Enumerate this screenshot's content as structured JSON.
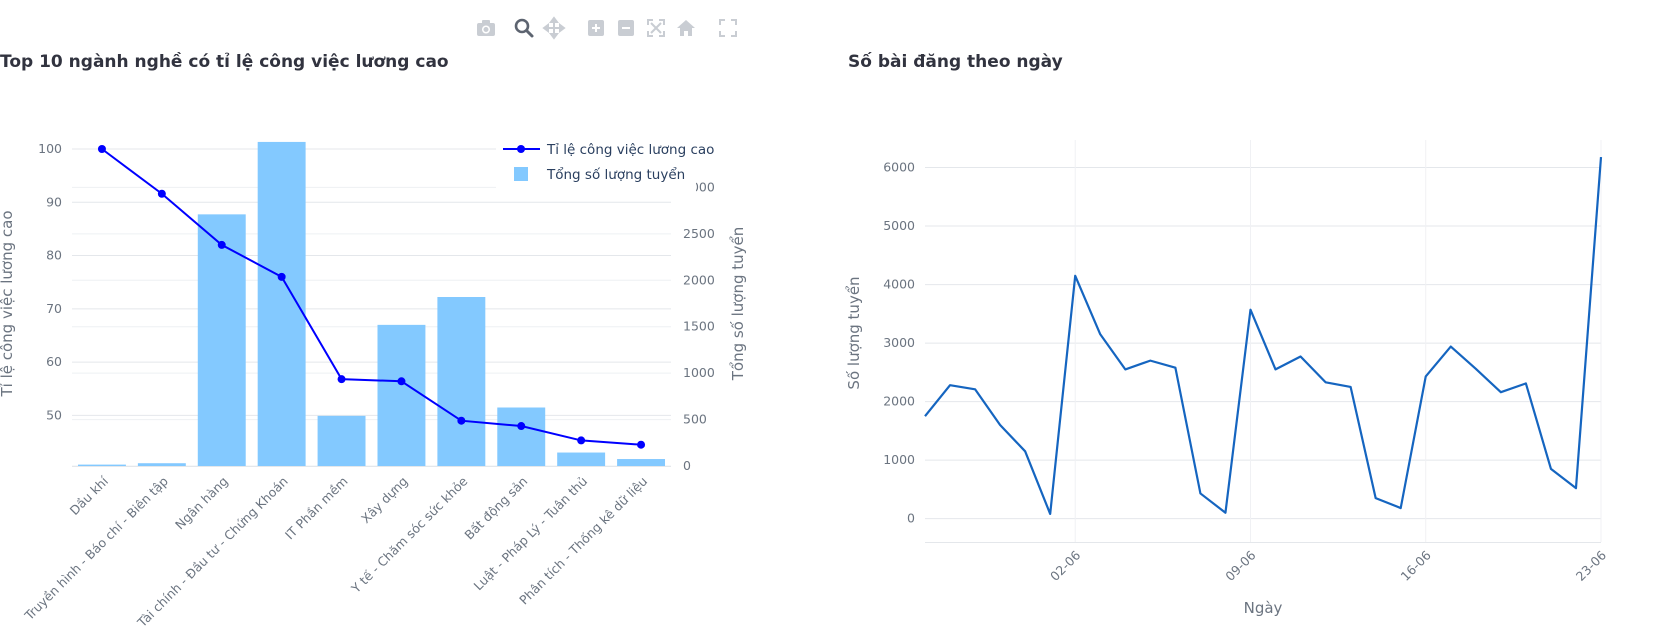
{
  "modebar": {
    "buttons": [
      {
        "name": "camera-icon",
        "label": "Download plot as a png",
        "active": false
      },
      {
        "name": "zoom-icon",
        "label": "Zoom",
        "active": true
      },
      {
        "name": "pan-icon",
        "label": "Pan",
        "active": false
      },
      {
        "name": "zoom-in-icon",
        "label": "Zoom in",
        "active": false
      },
      {
        "name": "zoom-out-icon",
        "label": "Zoom out",
        "active": false
      },
      {
        "name": "autoscale-icon",
        "label": "Autoscale",
        "active": false
      },
      {
        "name": "home-icon",
        "label": "Reset axes",
        "active": false
      },
      {
        "name": "fullscreen-icon",
        "label": "Fullscreen",
        "active": false
      }
    ]
  },
  "chart_data": [
    {
      "type": "bar",
      "title": "Top 10 ngành nghề có tỉ lệ công việc lương cao",
      "xlabel": "",
      "categories": [
        "Dầu khí",
        "Truyền hình - Báo chí - Biên tập",
        "Ngân hàng",
        "Tài chính - Đầu tư - Chứng Khoán",
        "IT Phần mềm",
        "Xây dựng",
        "Y tế - Chăm sóc sức khỏe",
        "Bất động sản",
        "Luật - Pháp Lý - Tuân thủ",
        "Phân tích - Thống kê dữ liệu"
      ],
      "y1label": "Tỉ lệ công việc lương cao",
      "y2label": "Tổng số lượng tuyển",
      "y1lim": [
        40.5,
        101.5
      ],
      "y2lim": [
        0,
        3500
      ],
      "y1ticks": [
        50,
        60,
        70,
        80,
        90,
        100
      ],
      "y2ticks": [
        0,
        500,
        1000,
        1500,
        2000,
        2500,
        3000
      ],
      "series": [
        {
          "name": "Tỉ lệ công việc lương cao",
          "type": "line",
          "axis": "y1",
          "color": "#0000ff",
          "values": [
            100,
            91.6,
            82,
            76,
            56.8,
            56.4,
            49,
            48,
            45.3,
            44.5
          ]
        },
        {
          "name": "Tổng số lượng tuyển",
          "type": "bar",
          "axis": "y2",
          "color": "#83c9ff",
          "values": [
            15,
            30,
            2710,
            3490,
            540,
            1520,
            1820,
            630,
            145,
            75
          ]
        }
      ],
      "legend": "top-right",
      "grid": true
    },
    {
      "type": "line",
      "title": "Số bài đăng theo ngày",
      "xlabel": "Ngày",
      "ylabel": "Số lượng tuyển",
      "ylim": [
        -400,
        6300
      ],
      "yticks": [
        0,
        1000,
        2000,
        3000,
        4000,
        5000,
        6000
      ],
      "xlim": [
        "2024-05-27",
        "2024-06-23"
      ],
      "xticks": [
        {
          "date": "2024-06-02",
          "label": "02-06"
        },
        {
          "date": "2024-06-09",
          "label": "09-06"
        },
        {
          "date": "2024-06-16",
          "label": "16-06"
        },
        {
          "date": "2024-06-23",
          "label": "23-06"
        }
      ],
      "color": "#1565c0",
      "grid": true,
      "x": [
        "2024-05-27",
        "2024-05-28",
        "2024-05-29",
        "2024-05-30",
        "2024-05-31",
        "2024-06-01",
        "2024-06-02",
        "2024-06-03",
        "2024-06-04",
        "2024-06-05",
        "2024-06-06",
        "2024-06-07",
        "2024-06-08",
        "2024-06-09",
        "2024-06-10",
        "2024-06-11",
        "2024-06-12",
        "2024-06-13",
        "2024-06-14",
        "2024-06-15",
        "2024-06-16",
        "2024-06-17",
        "2024-06-18",
        "2024-06-19",
        "2024-06-20",
        "2024-06-21",
        "2024-06-22",
        "2024-06-23"
      ],
      "y": [
        1750,
        2280,
        2210,
        1600,
        1150,
        80,
        4150,
        3150,
        2550,
        2700,
        2580,
        430,
        100,
        3570,
        2550,
        2770,
        2330,
        2250,
        350,
        180,
        2430,
        2940,
        2560,
        2160,
        2310,
        850,
        520,
        6180
      ]
    }
  ]
}
